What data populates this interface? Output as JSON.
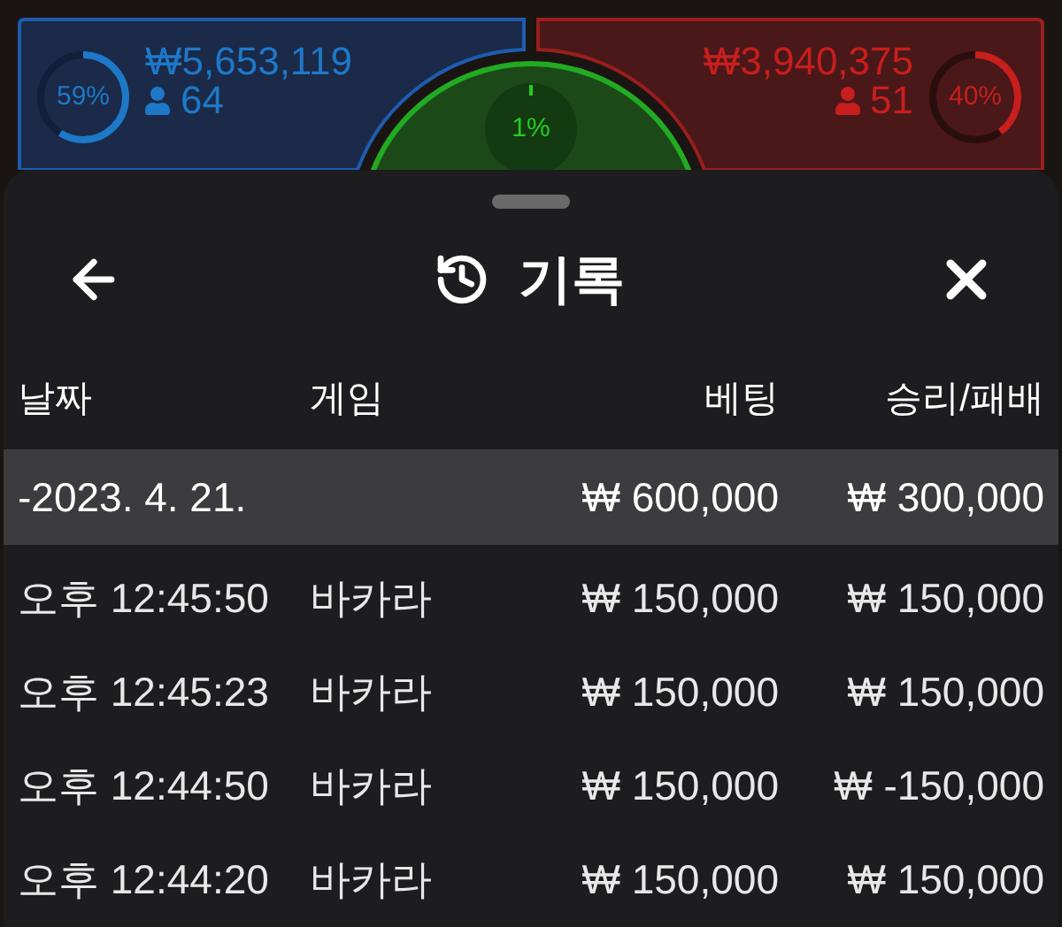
{
  "player": {
    "amount": "₩5,653,119",
    "count": "64",
    "percent": "59%"
  },
  "banker": {
    "amount": "₩3,940,375",
    "count": "51",
    "percent": "40%"
  },
  "tie": {
    "percent": "1%"
  },
  "sheet": {
    "title": "기록"
  },
  "columns": [
    "날짜",
    "게임",
    "베팅",
    "승리/패배"
  ],
  "groups": [
    {
      "date": "-2023. 4. 21.",
      "bet": "₩ 600,000",
      "result": "₩ 300,000",
      "rows": [
        {
          "time": "오후 12:45:50",
          "game": "바카라",
          "bet": "₩ 150,000",
          "result": "₩ 150,000"
        },
        {
          "time": "오후 12:45:23",
          "game": "바카라",
          "bet": "₩ 150,000",
          "result": "₩ 150,000"
        },
        {
          "time": "오후 12:44:50",
          "game": "바카라",
          "bet": "₩ 150,000",
          "result": "₩ -150,000"
        },
        {
          "time": "오후 12:44:20",
          "game": "바카라",
          "bet": "₩ 150,000",
          "result": "₩ 150,000"
        }
      ]
    }
  ]
}
